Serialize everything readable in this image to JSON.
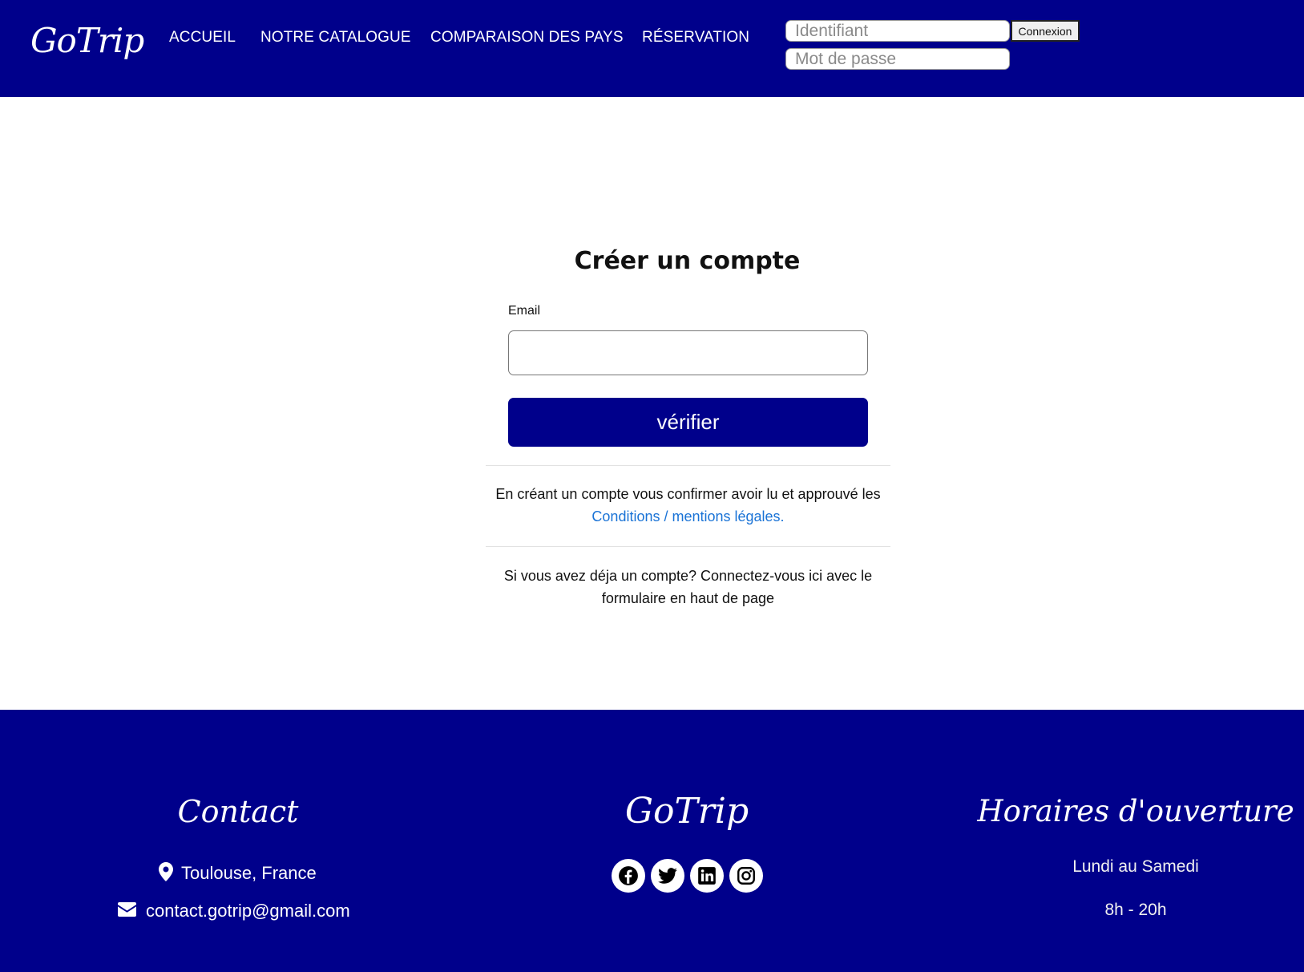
{
  "header": {
    "logo": "GoTrip",
    "nav": [
      "ACCUEIL",
      "NOTRE CATALOGUE",
      "COMPARAISON DES PAYS",
      "RÉSERVATION"
    ],
    "login": {
      "username_placeholder": "Identifiant",
      "password_placeholder": "Mot de passe",
      "button": "Connexion"
    }
  },
  "main": {
    "title": "Créer un compte",
    "email_label": "Email",
    "email_value": "",
    "verify_button": "vérifier",
    "terms_prefix": "En créant un compte vous confirmer avoir lu et approuvé les",
    "terms_link": "Conditions / mentions légales.",
    "existing_account": "Si vous avez déja un compte? Connectez-vous ici avec le formulaire en haut de page"
  },
  "footer": {
    "contact_title": "Contact",
    "location": "Toulouse, France",
    "email": "contact.gotrip@gmail.com",
    "brand": "GoTrip",
    "social": [
      "facebook-icon",
      "twitter-icon",
      "linkedin-icon",
      "instagram-icon"
    ],
    "hours_title": "Horaires d'ouverture",
    "hours_days": "Lundi au Samedi",
    "hours_time": "8h - 20h"
  },
  "colors": {
    "brand_blue": "#00008b",
    "link_blue": "#1a73d6"
  }
}
